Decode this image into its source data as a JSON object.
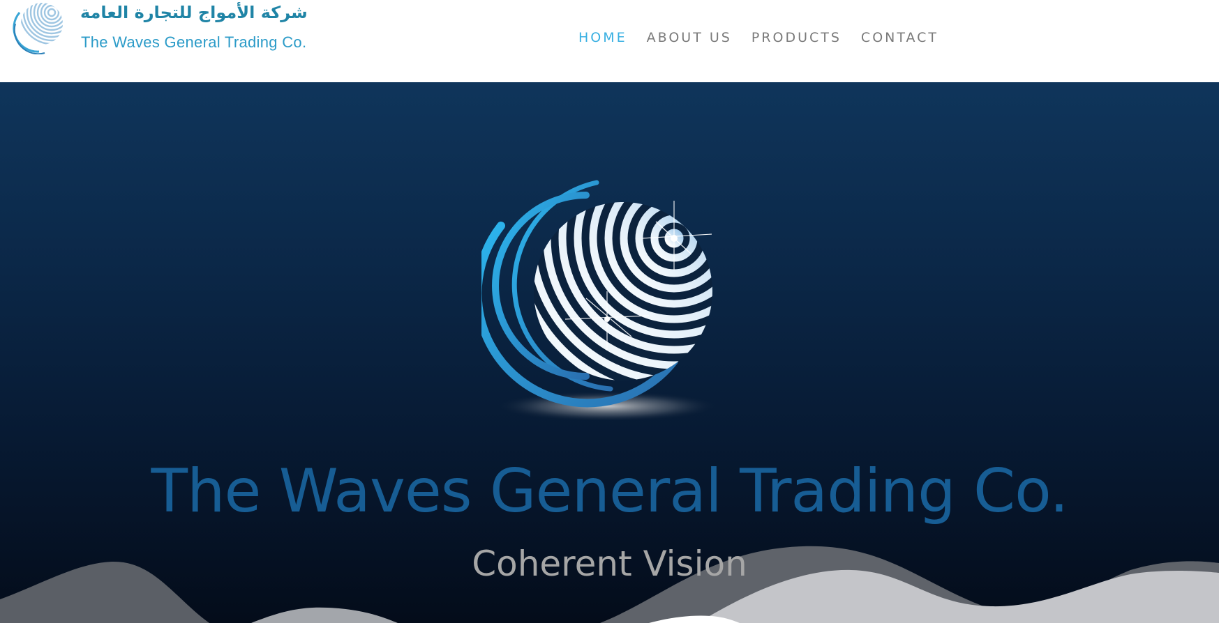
{
  "brand": {
    "name_ar": "شركة الأمواج للتجارة العامة",
    "name_en": "The Waves General Trading Co.",
    "logo_icon": "wave-globe-icon"
  },
  "nav": {
    "items": [
      {
        "label": "HOME",
        "active": true
      },
      {
        "label": "ABOUT US",
        "active": false
      },
      {
        "label": "PRODUCTS",
        "active": false
      },
      {
        "label": "CONTACT",
        "active": false
      }
    ]
  },
  "hero": {
    "title": "The Waves General Trading Co.",
    "subtitle": "Coherent Vision",
    "graphic_icon": "striped-globe-logo-icon"
  },
  "colors": {
    "accent": "#3ab0e2",
    "brand_ar": "#1f84a6",
    "hero_title": "#175d94",
    "hero_bg_top": "#0f355b",
    "hero_bg_bottom": "#040c1a"
  }
}
